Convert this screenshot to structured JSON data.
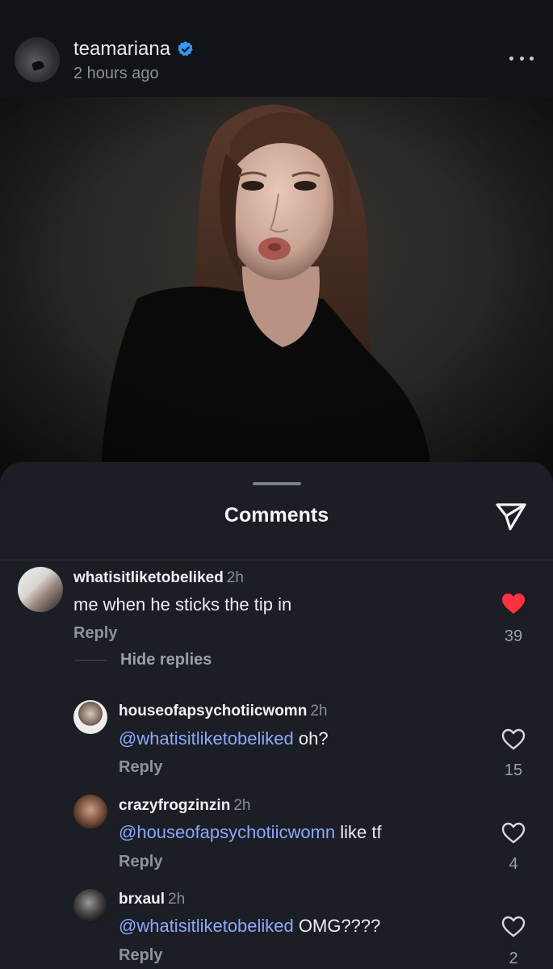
{
  "post": {
    "username": "teamariana",
    "time_ago": "2 hours ago",
    "verified": true
  },
  "sheet": {
    "title": "Comments"
  },
  "comments": [
    {
      "username": "whatisitliketobeliked",
      "age": "2h",
      "mention": "",
      "text": "me when he sticks the tip in",
      "reply_label": "Reply",
      "likes": "39",
      "liked": true
    }
  ],
  "hide_replies_label": "Hide replies",
  "replies": [
    {
      "username": "houseofapsychotiicwomn",
      "age": "2h",
      "mention": "@whatisitliketobeliked",
      "text": " oh?",
      "reply_label": "Reply",
      "likes": "15",
      "liked": false
    },
    {
      "username": "crazyfrogzinzin",
      "age": "2h",
      "mention": "@houseofapsychotiicwomn",
      "text": " like tf",
      "reply_label": "Reply",
      "likes": "4",
      "liked": false
    },
    {
      "username": "brxaul",
      "age": "2h",
      "mention": "@whatisitliketobeliked",
      "text": " OMG????",
      "reply_label": "Reply",
      "likes": "2",
      "liked": false
    }
  ],
  "colors": {
    "background": "#101318",
    "sheet": "#1b1e24",
    "mention": "#8aa9ff",
    "like_active": "#ff3040",
    "verified": "#3897f0"
  },
  "icons": [
    "verified-badge-icon",
    "more-icon",
    "share-send-icon",
    "heart-filled-icon",
    "heart-outline-icon"
  ]
}
